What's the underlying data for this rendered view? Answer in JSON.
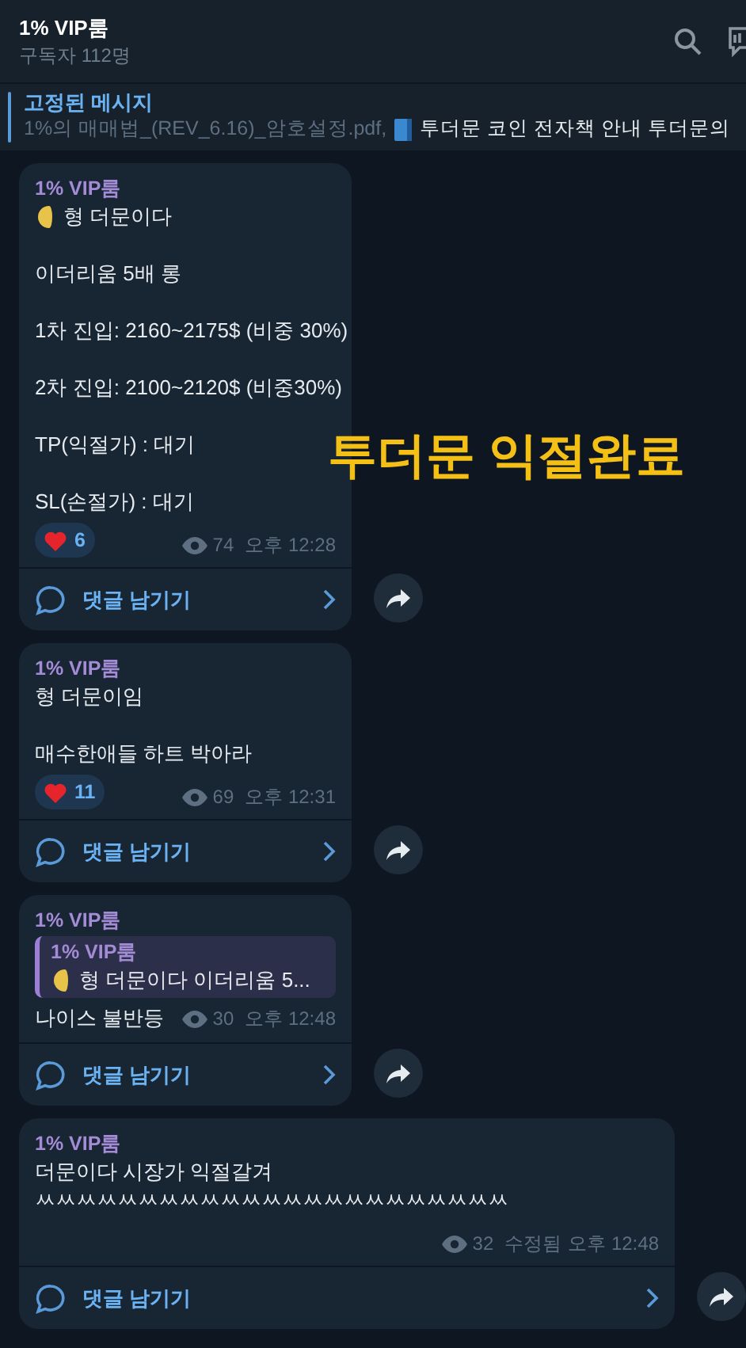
{
  "header": {
    "title": "1% VIP룸",
    "subtitle": "구독자 112명"
  },
  "pinned": {
    "label": "고정된 메시지",
    "file": "1%의 매매법_(REV_6.16)_암호설정.pdf,",
    "preview": "투더문 코인 전자책 안내  투더문의"
  },
  "overlay_caption": "투더문 익절완료",
  "messages": [
    {
      "sender": "1% VIP룸",
      "paragraphs": [
        {
          "kind": "emoji",
          "lines": [
            "형 더문이다"
          ]
        },
        {
          "lines": [
            "이더리움 5배 롱"
          ]
        },
        {
          "lines": [
            "1차 진입: 2160~2175$ (비중 30%)"
          ]
        },
        {
          "lines": [
            "2차 진입: 2100~2120$ (비중30%)"
          ]
        },
        {
          "lines": [
            "TP(익절가) : 대기"
          ]
        },
        {
          "lines": [
            "SL(손절가) : 대기"
          ]
        }
      ],
      "reaction": {
        "count": "6"
      },
      "views": "74",
      "time": "오후 12:28",
      "comment": "댓글 남기기"
    },
    {
      "sender": "1% VIP룸",
      "paragraphs": [
        {
          "lines": [
            "형 더문이임"
          ]
        },
        {
          "lines": [
            "매수한애들 하트 박아라"
          ]
        }
      ],
      "reaction": {
        "count": "11"
      },
      "views": "69",
      "time": "오후 12:31",
      "comment": "댓글 남기기"
    },
    {
      "sender": "1% VIP룸",
      "reply": {
        "sender": "1% VIP룸",
        "kind": "emoji",
        "text": "형 더문이다  이더리움 5..."
      },
      "paragraphs": [
        {
          "lines": [
            "나이스 불반등"
          ]
        }
      ],
      "views": "30",
      "time": "오후 12:48",
      "comment": "댓글 남기기"
    },
    {
      "sender": "1% VIP룸",
      "paragraphs": [
        {
          "lines": [
            "더문이다 시장가 익절갈겨",
            "ㅆㅆㅆㅆㅆㅆㅆㅆㅆㅆㅆㅆㅆㅆㅆㅆㅆㅆㅆㅆㅆㅆㅆ"
          ]
        }
      ],
      "views": "32",
      "edited": "수정됨",
      "time": "오후 12:48",
      "comment": "댓글 남기기",
      "kind": "wide"
    }
  ]
}
